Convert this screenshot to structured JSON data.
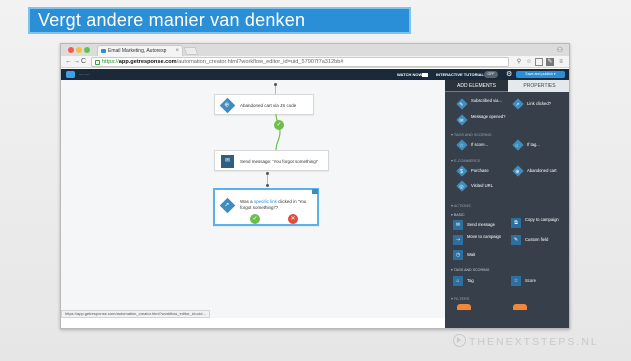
{
  "slide": {
    "title": "Vergt andere manier van denken",
    "watermark": "THENEXTSTEPS.NL"
  },
  "browser": {
    "tab_title": "Email Marketing, Autoresp",
    "url_scheme": "https://",
    "url_host": "app.getresponse.com",
    "url_path": "/automation_creator.html?workflow_editor_id=uid_57907f7a312bb#",
    "status_url": "https://app.getresponse.com/automation_creator.html?workflow_editor_id=uid..."
  },
  "appbar": {
    "watch_now": "WATCH NOW",
    "interactive_tutorial": "INTERACTIVE TUTORIAL",
    "tutorial_toggle": "OFF",
    "save_publish": "Save and publish"
  },
  "workflow": {
    "node_trigger": "Abandoned cart via JS code",
    "node_send": "Send message: 'You forgot something!'",
    "node_condition_prefix": "Was a",
    "node_condition_link": "specific link",
    "node_condition_suffix": "clicked in 'You forgot something!'?",
    "yes_symbol": "✓",
    "no_symbol": "✕"
  },
  "panel": {
    "tab_add": "ADD ELEMENTS",
    "tab_properties": "PROPERTIES",
    "conditions": [
      {
        "label": "Subscribed via..."
      },
      {
        "label": "Link clicked?"
      },
      {
        "label": "Message opened?"
      }
    ],
    "sec_tags_scoring": "TAGS AND SCORING",
    "tag_conditions": [
      {
        "label": "If score..."
      },
      {
        "label": "If tag..."
      }
    ],
    "sec_ecommerce": "E-COMMERCE",
    "ecommerce": [
      {
        "label": "Purchase"
      },
      {
        "label": "Abandoned cart"
      },
      {
        "label": "Visited URL"
      }
    ],
    "sec_actions": "ACTIONS",
    "sub_basic": "BASIC",
    "actions": [
      {
        "label": "Send message"
      },
      {
        "label": "Copy to campaign"
      },
      {
        "label": "Move to campaign"
      },
      {
        "label": "Custom field"
      },
      {
        "label": "Wait"
      }
    ],
    "sub_tags_scoring": "TAGS AND SCORING",
    "tag_actions": [
      {
        "label": "Tag"
      },
      {
        "label": "Score"
      }
    ],
    "sec_filters": "FILTERS"
  }
}
